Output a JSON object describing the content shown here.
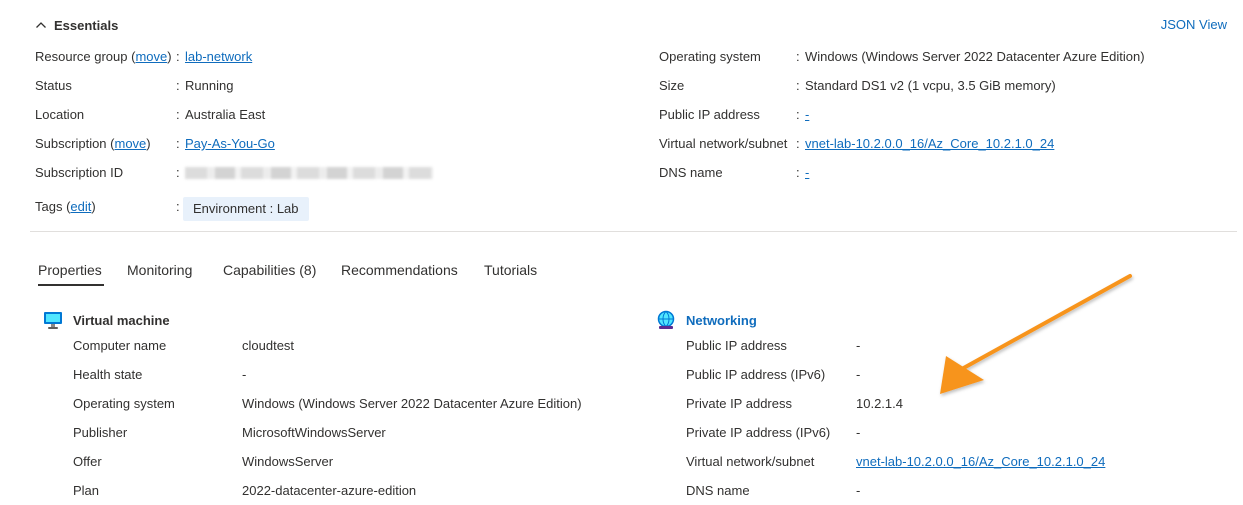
{
  "essentials": {
    "title": "Essentials",
    "json_view": "JSON View",
    "left": [
      {
        "label_prefix": "Resource group (",
        "label_link": "move",
        "label_suffix": ")",
        "colon": ":",
        "value": "lab-network",
        "value_is_link": true
      },
      {
        "label": "Status",
        "colon": ":",
        "value": "Running"
      },
      {
        "label": "Location",
        "colon": ":",
        "value": "Australia East"
      },
      {
        "label_prefix": "Subscription (",
        "label_link": "move",
        "label_suffix": ")",
        "colon": ":",
        "value": "Pay-As-You-Go",
        "value_is_link": true
      },
      {
        "label": "Subscription ID",
        "colon": ":",
        "value": ""
      },
      {
        "label_prefix": "Tags (",
        "label_link": "edit",
        "label_suffix": ")",
        "colon": ":",
        "value": "Environment : Lab"
      }
    ],
    "right": [
      {
        "label": "Operating system",
        "colon": ":",
        "value": "Windows (Windows Server 2022 Datacenter Azure Edition)"
      },
      {
        "label": "Size",
        "colon": ":",
        "value": "Standard DS1 v2 (1 vcpu, 3.5 GiB memory)"
      },
      {
        "label": "Public IP address",
        "colon": ":",
        "value": "-"
      },
      {
        "label": "Virtual network/subnet",
        "colon": ":",
        "value": "vnet-lab-10.2.0.0_16/Az_Core_10.2.1.0_24"
      },
      {
        "label": "DNS name",
        "colon": ":",
        "value": "-"
      }
    ]
  },
  "tabs": [
    "Properties",
    "Monitoring",
    "Capabilities (8)",
    "Recommendations",
    "Tutorials"
  ],
  "vm": {
    "title": "Virtual machine",
    "rows": [
      {
        "label": "Computer name",
        "value": "cloudtest"
      },
      {
        "label": "Health state",
        "value": "-"
      },
      {
        "label": "Operating system",
        "value": "Windows (Windows Server 2022 Datacenter Azure Edition)"
      },
      {
        "label": "Publisher",
        "value": "MicrosoftWindowsServer"
      },
      {
        "label": "Offer",
        "value": "WindowsServer"
      },
      {
        "label": "Plan",
        "value": "2022-datacenter-azure-edition"
      }
    ]
  },
  "networking": {
    "title": "Networking",
    "rows": [
      {
        "label": "Public IP address",
        "value": "-"
      },
      {
        "label": "Public IP address (IPv6)",
        "value": "-"
      },
      {
        "label": "Private IP address",
        "value": "10.2.1.4"
      },
      {
        "label": "Private IP address (IPv6)",
        "value": "-"
      },
      {
        "label": "Virtual network/subnet",
        "value": "vnet-lab-10.2.0.0_16/Az_Core_10.2.1.0_24"
      },
      {
        "label": "DNS name",
        "value": "-"
      }
    ]
  },
  "colors": {
    "link": "#0f6cbd",
    "arrow": "#f7941d",
    "tag_bg": "#e8f1fb"
  },
  "icons": {
    "collapse": "chevron-up-icon",
    "vm": "virtual-machine-icon",
    "networking": "networking-icon",
    "annotation": "orange-arrow-annotation"
  }
}
